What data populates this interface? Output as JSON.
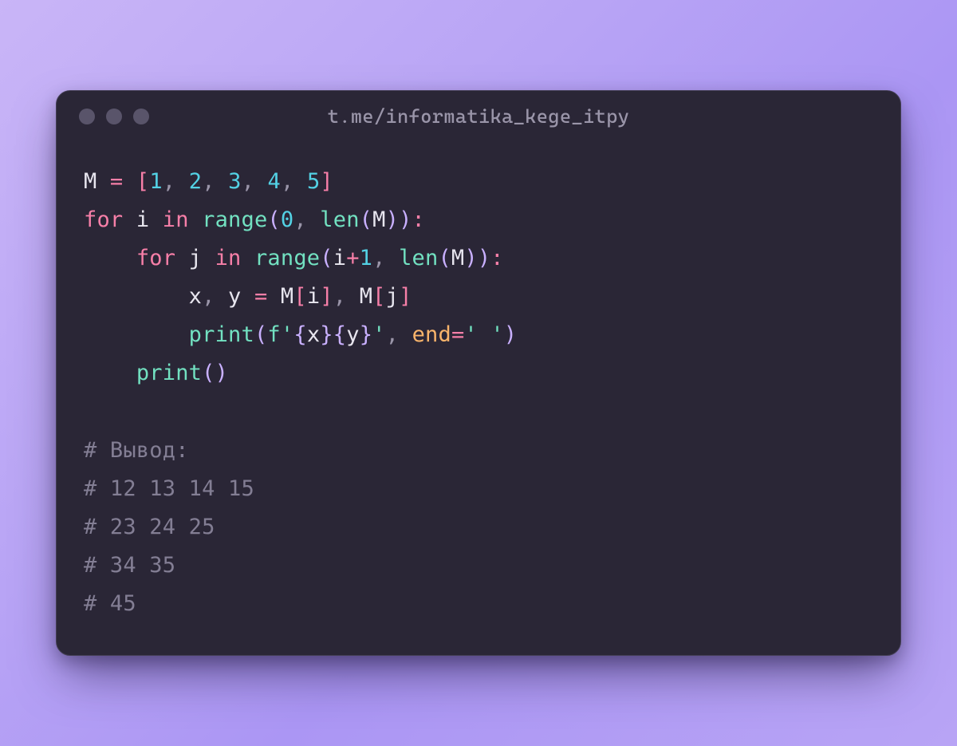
{
  "window": {
    "title": "t.me/informatika_kege_itpy"
  },
  "code": {
    "lines": [
      {
        "indent": 0,
        "tokens": [
          {
            "t": "M ",
            "c": "tok-default"
          },
          {
            "t": "=",
            "c": "tok-op"
          },
          {
            "t": " ",
            "c": "tok-default"
          },
          {
            "t": "[",
            "c": "tok-bracket"
          },
          {
            "t": "1",
            "c": "tok-num"
          },
          {
            "t": ",",
            "c": "tok-punct"
          },
          {
            "t": " ",
            "c": "tok-default"
          },
          {
            "t": "2",
            "c": "tok-num"
          },
          {
            "t": ",",
            "c": "tok-punct"
          },
          {
            "t": " ",
            "c": "tok-default"
          },
          {
            "t": "3",
            "c": "tok-num"
          },
          {
            "t": ",",
            "c": "tok-punct"
          },
          {
            "t": " ",
            "c": "tok-default"
          },
          {
            "t": "4",
            "c": "tok-num"
          },
          {
            "t": ",",
            "c": "tok-punct"
          },
          {
            "t": " ",
            "c": "tok-default"
          },
          {
            "t": "5",
            "c": "tok-num"
          },
          {
            "t": "]",
            "c": "tok-bracket"
          }
        ]
      },
      {
        "indent": 0,
        "tokens": [
          {
            "t": "for",
            "c": "tok-kw"
          },
          {
            "t": " i ",
            "c": "tok-default"
          },
          {
            "t": "in",
            "c": "tok-kw"
          },
          {
            "t": " ",
            "c": "tok-default"
          },
          {
            "t": "range",
            "c": "tok-fn"
          },
          {
            "t": "(",
            "c": "tok-paren"
          },
          {
            "t": "0",
            "c": "tok-num"
          },
          {
            "t": ",",
            "c": "tok-punct"
          },
          {
            "t": " ",
            "c": "tok-default"
          },
          {
            "t": "len",
            "c": "tok-fn"
          },
          {
            "t": "(",
            "c": "tok-paren"
          },
          {
            "t": "M",
            "c": "tok-default"
          },
          {
            "t": "))",
            "c": "tok-paren"
          },
          {
            "t": ":",
            "c": "tok-op"
          }
        ]
      },
      {
        "indent": 1,
        "tokens": [
          {
            "t": "for",
            "c": "tok-kw"
          },
          {
            "t": " j ",
            "c": "tok-default"
          },
          {
            "t": "in",
            "c": "tok-kw"
          },
          {
            "t": " ",
            "c": "tok-default"
          },
          {
            "t": "range",
            "c": "tok-fn"
          },
          {
            "t": "(",
            "c": "tok-paren"
          },
          {
            "t": "i",
            "c": "tok-default"
          },
          {
            "t": "+",
            "c": "tok-op"
          },
          {
            "t": "1",
            "c": "tok-num"
          },
          {
            "t": ",",
            "c": "tok-punct"
          },
          {
            "t": " ",
            "c": "tok-default"
          },
          {
            "t": "len",
            "c": "tok-fn"
          },
          {
            "t": "(",
            "c": "tok-paren"
          },
          {
            "t": "M",
            "c": "tok-default"
          },
          {
            "t": "))",
            "c": "tok-paren"
          },
          {
            "t": ":",
            "c": "tok-op"
          }
        ]
      },
      {
        "indent": 2,
        "tokens": [
          {
            "t": "x",
            "c": "tok-default"
          },
          {
            "t": ",",
            "c": "tok-punct"
          },
          {
            "t": " y ",
            "c": "tok-default"
          },
          {
            "t": "=",
            "c": "tok-op"
          },
          {
            "t": " M",
            "c": "tok-default"
          },
          {
            "t": "[",
            "c": "tok-bracket"
          },
          {
            "t": "i",
            "c": "tok-default"
          },
          {
            "t": "]",
            "c": "tok-bracket"
          },
          {
            "t": ",",
            "c": "tok-punct"
          },
          {
            "t": " M",
            "c": "tok-default"
          },
          {
            "t": "[",
            "c": "tok-bracket"
          },
          {
            "t": "j",
            "c": "tok-default"
          },
          {
            "t": "]",
            "c": "tok-bracket"
          }
        ]
      },
      {
        "indent": 2,
        "tokens": [
          {
            "t": "print",
            "c": "tok-fn"
          },
          {
            "t": "(",
            "c": "tok-paren"
          },
          {
            "t": "f",
            "c": "tok-fn"
          },
          {
            "t": "'",
            "c": "tok-str"
          },
          {
            "t": "{",
            "c": "tok-brace"
          },
          {
            "t": "x",
            "c": "tok-default"
          },
          {
            "t": "}",
            "c": "tok-brace"
          },
          {
            "t": "{",
            "c": "tok-brace"
          },
          {
            "t": "y",
            "c": "tok-default"
          },
          {
            "t": "}",
            "c": "tok-brace"
          },
          {
            "t": "'",
            "c": "tok-str"
          },
          {
            "t": ",",
            "c": "tok-punct"
          },
          {
            "t": " ",
            "c": "tok-default"
          },
          {
            "t": "end",
            "c": "tok-param"
          },
          {
            "t": "=",
            "c": "tok-op"
          },
          {
            "t": "' '",
            "c": "tok-str"
          },
          {
            "t": ")",
            "c": "tok-paren"
          }
        ]
      },
      {
        "indent": 1,
        "tokens": [
          {
            "t": "print",
            "c": "tok-fn"
          },
          {
            "t": "()",
            "c": "tok-paren"
          }
        ]
      },
      {
        "indent": 0,
        "tokens": []
      },
      {
        "indent": 0,
        "tokens": [
          {
            "t": "# Вывод:",
            "c": "tok-comment"
          }
        ]
      },
      {
        "indent": 0,
        "tokens": [
          {
            "t": "# 12 13 14 15",
            "c": "tok-comment"
          }
        ]
      },
      {
        "indent": 0,
        "tokens": [
          {
            "t": "# 23 24 25",
            "c": "tok-comment"
          }
        ]
      },
      {
        "indent": 0,
        "tokens": [
          {
            "t": "# 34 35",
            "c": "tok-comment"
          }
        ]
      },
      {
        "indent": 0,
        "tokens": [
          {
            "t": "# 45",
            "c": "tok-comment"
          }
        ]
      }
    ],
    "indent_unit": "    "
  }
}
